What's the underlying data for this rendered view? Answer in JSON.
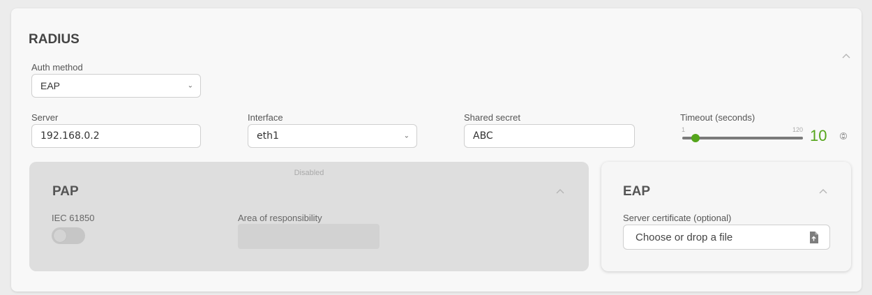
{
  "radius": {
    "title": "RADIUS",
    "auth_method": {
      "label": "Auth method",
      "value": "EAP"
    },
    "server": {
      "label": "Server",
      "value": "192.168.0.2"
    },
    "interface": {
      "label": "Interface",
      "value": "eth1"
    },
    "shared_secret": {
      "label": "Shared secret",
      "value": "ABC"
    },
    "timeout": {
      "label": "Timeout (seconds)",
      "min": "1",
      "max": "120",
      "value": "10",
      "fraction": 0.076
    }
  },
  "pap": {
    "title": "PAP",
    "status": "Disabled",
    "iec_label": "IEC 61850",
    "iec_enabled": false,
    "area_label": "Area of responsibility",
    "area_value": ""
  },
  "eap": {
    "title": "EAP",
    "cert_label": "Server certificate (optional)",
    "cert_placeholder": "Choose or drop a file"
  },
  "colors": {
    "accent": "#55a51b",
    "background": "#ececec",
    "card": "#f8f8f8",
    "disabled_panel": "#dedede"
  },
  "icons": [
    "chevron-up-icon",
    "chevron-down-icon",
    "spin-arrows-icon",
    "file-upload-icon"
  ]
}
